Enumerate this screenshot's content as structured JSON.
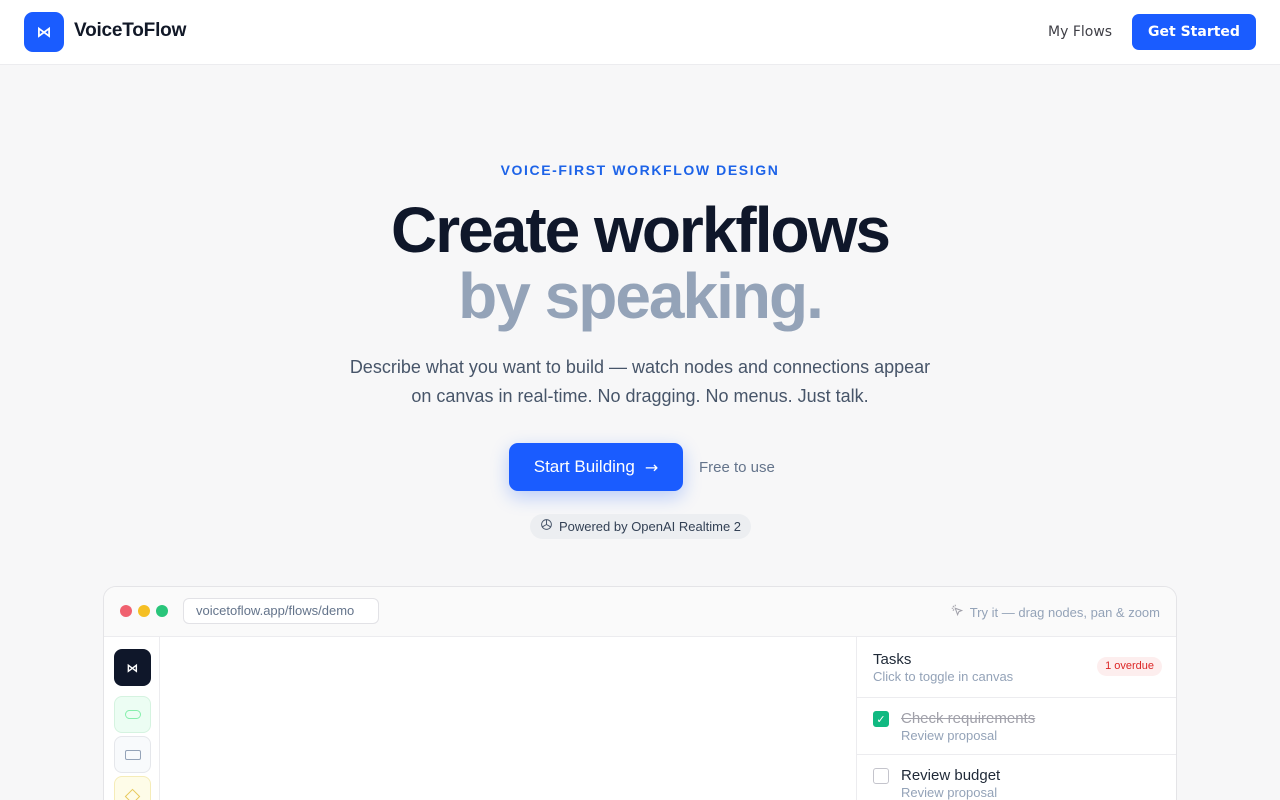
{
  "header": {
    "logo_glyph": "⋈",
    "brand": "VoiceToFlow",
    "nav_link": "My Flows",
    "cta": "Get Started"
  },
  "hero": {
    "eyebrow": "VOICE-FIRST WORKFLOW DESIGN",
    "title_line1": "Create workflows",
    "title_line2": "by speaking.",
    "subtitle": "Describe what you want to build — watch nodes and connections appear on canvas in real-time. No dragging. No menus. Just talk.",
    "primary_button": "Start Building",
    "primary_button_arrow": "→",
    "secondary_label": "Free to use",
    "powered_icon": "openai-icon",
    "powered_label": "Powered by OpenAI Realtime 2"
  },
  "demo": {
    "url": "voicetoflow.app/flows/demo",
    "hint": "Try it — drag nodes, pan & zoom",
    "hint_icon": "pointer-sparkle-icon",
    "sidebar_tools": [
      "logo",
      "start-node-tool",
      "action-node-tool",
      "decision-node-tool"
    ],
    "tasks": {
      "title": "Tasks",
      "subtitle": "Click to toggle in canvas",
      "badge": "1 overdue",
      "items": [
        {
          "title": "Check requirements",
          "subtitle": "Review proposal",
          "done": true
        },
        {
          "title": "Review budget",
          "subtitle": "Review proposal",
          "done": false
        }
      ]
    }
  },
  "colors": {
    "accent": "#1a5cff",
    "eyebrow": "#1d63e8",
    "title_muted": "#94a3b8",
    "check_done": "#10b981",
    "overdue": "#dc2626"
  }
}
